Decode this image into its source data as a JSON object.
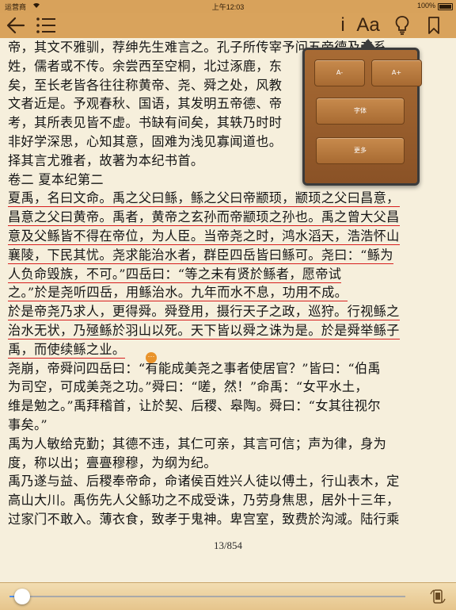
{
  "status": {
    "carrier": "运营商",
    "time": "上午12:03",
    "battery": "100%"
  },
  "nav": {
    "info_label": "i",
    "font_label": "Aa"
  },
  "lines": [
    {
      "type": "plain",
      "text": "帝，其文不雅驯，荐绅先生难言之。孔子所传宰予问五帝德及帝系"
    },
    {
      "type": "plain",
      "text": "姓，儒者或不传。余尝西至空桐，北过涿鹿，东"
    },
    {
      "type": "plain",
      "text": "矣，至长老皆各往往称黄帝、尧、舜之处，风教"
    },
    {
      "type": "plain",
      "text": "文者近是。予观春秋、国语，其发明五帝德、帝"
    },
    {
      "type": "plain",
      "text": "考，其所表见皆不虚。书缺有间矣，其轶乃时时"
    },
    {
      "type": "plain",
      "text": "非好学深思，心知其意，固难为浅见寡闻道也。"
    },
    {
      "type": "plain",
      "text": "择其言尤雅者，故著为本纪书首。"
    },
    {
      "type": "plain",
      "text": "卷二 夏本纪第二"
    },
    {
      "type": "ul",
      "text": "夏禹，名曰文命。禹之父曰鲧，鲧之父曰帝颛顼，颛顼之父曰昌意，"
    },
    {
      "type": "ul",
      "text": "昌意之父曰黄帝。禹者，黄帝之玄孙而帝颛顼之孙也。禹之曾大父昌"
    },
    {
      "type": "ul",
      "text": "意及父鲧皆不得在帝位，为人臣。当帝尧之时，鸿水滔天，浩浩怀山"
    },
    {
      "type": "ul",
      "text": "襄陵，下民其忧。尧求能治水者，群臣四岳皆曰鲧可。尧曰：“鲧为"
    },
    {
      "type": "ul",
      "text": "人负命毁族，不可。”四岳曰：“等之未有贤於鲧者，愿帝试"
    },
    {
      "type": "ul",
      "text": "之。”於是尧听四岳，用鲧治水。九年而水不息，功用不成。"
    },
    {
      "type": "ul",
      "text": "於是帝尧乃求人，更得舜。舜登用，摄行天子之政，巡狩。行视鲧之"
    },
    {
      "type": "ul",
      "text": "治水无状，乃殛鲧於羽山以死。天下皆以舜之诛为是。於是舜举鲧子"
    },
    {
      "type": "ul",
      "text": "禹，而使续鲧之业。"
    },
    {
      "type": "plain",
      "text": "尧崩，帝舜问四岳曰：“有能成美尧之事者使居官？”皆曰：“伯禹"
    },
    {
      "type": "plain",
      "text": "为司空，可成美尧之功。”舜曰：“嗟，然！”命禹：“女平水土，"
    },
    {
      "type": "plain",
      "text": "维是勉之。”禹拜稽首，让於契、后稷、皋陶。舜曰：“女其往视尔"
    },
    {
      "type": "plain",
      "text": "事矣。”"
    },
    {
      "type": "plain",
      "text": "禹为人敏给克勤；其德不违，其仁可亲，其言可信；声为律，身为"
    },
    {
      "type": "plain",
      "text": "度，称以出；亹亹穆穆，为纲为纪。"
    },
    {
      "type": "plain",
      "text": "禹乃遂与益、后稷奉帝命，命诸侯百姓兴人徒以傅土，行山表木，定"
    },
    {
      "type": "plain",
      "text": "高山大川。禹伤先人父鲧功之不成受诛，乃劳身焦思，居外十三年，"
    },
    {
      "type": "plain",
      "text": "过家门不敢入。薄衣食，致孝于鬼神。卑宫室，致费於沟淢。陆行乘"
    }
  ],
  "page_indicator": "13/854",
  "progress": {
    "fraction": 0.015
  },
  "popup": {
    "decrease_label": "A-",
    "increase_label": "A+",
    "font_label": "字体",
    "more_label": "更多"
  },
  "colors": {
    "toolbar": "#d9a35c",
    "page": "#f6efdc",
    "underline": "#d81e1e",
    "popup": "#9a5e2c"
  }
}
